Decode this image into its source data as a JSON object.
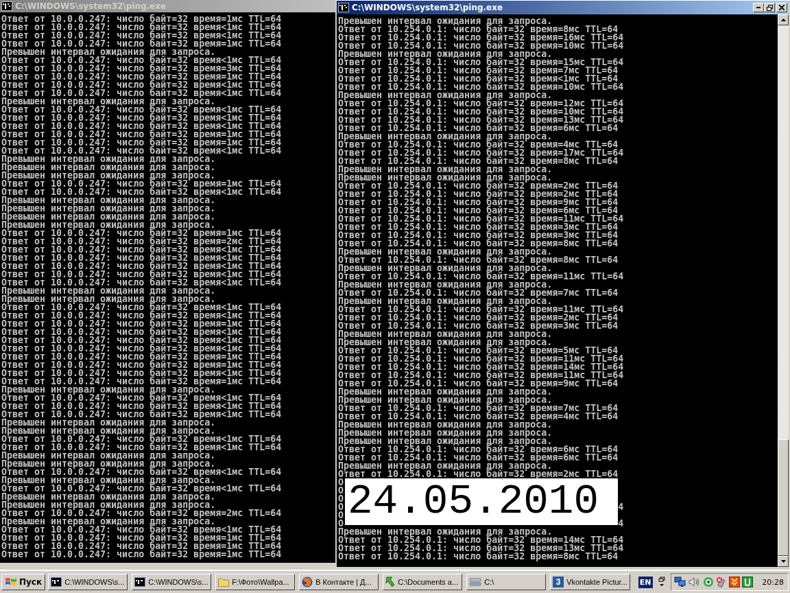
{
  "windows": [
    {
      "title": "C:\\WINDOWS\\system32\\ping.exe",
      "active": false,
      "lines": [
        {
          "kind": "text",
          "text": "Ответ от 10.0.0.247: число байт=32 время=1мс TTL=64"
        },
        {
          "kind": "text",
          "text": "Ответ от 10.0.0.247: число байт=32 время<1мс TTL=64"
        },
        {
          "kind": "text",
          "text": "Ответ от 10.0.0.247: число байт=32 время<1мс TTL=64"
        },
        {
          "kind": "text",
          "text": "Ответ от 10.0.0.247: число байт=32 время=1мс TTL=64"
        },
        {
          "kind": "text",
          "text": "Превышен интервал ожидания для запроса."
        },
        {
          "kind": "text",
          "text": "Ответ от 10.0.0.247: число байт=32 время<1мс TTL=64"
        },
        {
          "kind": "text",
          "text": "Ответ от 10.0.0.247: число байт=32 время=3мс TTL=64"
        },
        {
          "kind": "text",
          "text": "Ответ от 10.0.0.247: число байт=32 время=1мс TTL=64"
        },
        {
          "kind": "text",
          "text": "Ответ от 10.0.0.247: число байт=32 время<1мс TTL=64"
        },
        {
          "kind": "text",
          "text": "Ответ от 10.0.0.247: число байт=32 время<1мс TTL=64"
        },
        {
          "kind": "text",
          "text": "Превышен интервал ожидания для запроса."
        },
        {
          "kind": "text",
          "text": "Ответ от 10.0.0.247: число байт=32 время<1мс TTL=64"
        },
        {
          "kind": "text",
          "text": "Ответ от 10.0.0.247: число байт=32 время<1мс TTL=64"
        },
        {
          "kind": "text",
          "text": "Ответ от 10.0.0.247: число байт=32 время<1мс TTL=64"
        },
        {
          "kind": "text",
          "text": "Ответ от 10.0.0.247: число байт=32 время=1мс TTL=64"
        },
        {
          "kind": "text",
          "text": "Ответ от 10.0.0.247: число байт=32 время=1мс TTL=64"
        },
        {
          "kind": "text",
          "text": "Ответ от 10.0.0.247: число байт=32 время<1мс TTL=64"
        },
        {
          "kind": "text",
          "text": "Превышен интервал ожидания для запроса."
        },
        {
          "kind": "text",
          "text": "Превышен интервал ожидания для запроса."
        },
        {
          "kind": "text",
          "text": "Превышен интервал ожидания для запроса."
        },
        {
          "kind": "text",
          "text": "Ответ от 10.0.0.247: число байт=32 время=1мс TTL=64"
        },
        {
          "kind": "text",
          "text": "Ответ от 10.0.0.247: число байт=32 время<1мс TTL=64"
        },
        {
          "kind": "text",
          "text": "Превышен интервал ожидания для запроса."
        },
        {
          "kind": "text",
          "text": "Превышен интервал ожидания для запроса."
        },
        {
          "kind": "text",
          "text": "Превышен интервал ожидания для запроса."
        },
        {
          "kind": "text",
          "text": "Превышен интервал ожидания для запроса."
        },
        {
          "kind": "text",
          "text": "Ответ от 10.0.0.247: число байт=32 время=1мс TTL=64"
        },
        {
          "kind": "text",
          "text": "Ответ от 10.0.0.247: число байт=32 время=2мс TTL=64"
        },
        {
          "kind": "text",
          "text": "Ответ от 10.0.0.247: число байт=32 время<1мс TTL=64"
        },
        {
          "kind": "text",
          "text": "Ответ от 10.0.0.247: число байт=32 время<1мс TTL=64"
        },
        {
          "kind": "text",
          "text": "Ответ от 10.0.0.247: число байт=32 время<1мс TTL=64"
        },
        {
          "kind": "text",
          "text": "Ответ от 10.0.0.247: число байт=32 время<1мс TTL=64"
        },
        {
          "kind": "text",
          "text": "Ответ от 10.0.0.247: число байт=32 время<1мс TTL=64"
        },
        {
          "kind": "text",
          "text": "Превышен интервал ожидания для запроса."
        },
        {
          "kind": "text",
          "text": "Превышен интервал ожидания для запроса."
        },
        {
          "kind": "text",
          "text": "Ответ от 10.0.0.247: число байт=32 время<1мс TTL=64"
        },
        {
          "kind": "text",
          "text": "Ответ от 10.0.0.247: число байт=32 время<1мс TTL=64"
        },
        {
          "kind": "text",
          "text": "Ответ от 10.0.0.247: число байт=32 время=1мс TTL=64"
        },
        {
          "kind": "text",
          "text": "Ответ от 10.0.0.247: число байт=32 время<1мс TTL=64"
        },
        {
          "kind": "text",
          "text": "Ответ от 10.0.0.247: число байт=32 время<1мс TTL=64"
        },
        {
          "kind": "text",
          "text": "Ответ от 10.0.0.247: число байт=32 время<1мс TTL=64"
        },
        {
          "kind": "text",
          "text": "Ответ от 10.0.0.247: число байт=32 время=1мс TTL=64"
        },
        {
          "kind": "text",
          "text": "Ответ от 10.0.0.247: число байт=32 время=1мс TTL=64"
        },
        {
          "kind": "text",
          "text": "Ответ от 10.0.0.247: число байт=32 время<1мс TTL=64"
        },
        {
          "kind": "text",
          "text": "Ответ от 10.0.0.247: число байт=32 время=1мс TTL=64"
        },
        {
          "kind": "text",
          "text": "Превышен интервал ожидания для запроса."
        },
        {
          "kind": "text",
          "text": "Ответ от 10.0.0.247: число байт=32 время<1мс TTL=64"
        },
        {
          "kind": "text",
          "text": "Ответ от 10.0.0.247: число байт=32 время<1мс TTL=64"
        },
        {
          "kind": "text",
          "text": "Ответ от 10.0.0.247: число байт=32 время<1мс TTL=64"
        },
        {
          "kind": "text",
          "text": "Превышен интервал ожидания для запроса."
        },
        {
          "kind": "text",
          "text": "Превышен интервал ожидания для запроса."
        },
        {
          "kind": "text",
          "text": "Ответ от 10.0.0.247: число байт=32 время<1мс TTL=64"
        },
        {
          "kind": "text",
          "text": "Ответ от 10.0.0.247: число байт=32 время<1мс TTL=64"
        },
        {
          "kind": "text",
          "text": "Превышен интервал ожидания для запроса."
        },
        {
          "kind": "text",
          "text": "Превышен интервал ожидания для запроса."
        },
        {
          "kind": "text",
          "text": "Ответ от 10.0.0.247: число байт=32 время<1мс TTL=64"
        },
        {
          "kind": "text",
          "text": "Превышен интервал ожидания для запроса."
        },
        {
          "kind": "text",
          "text": "Ответ от 10.0.0.247: число байт=32 время<1мс TTL=64"
        },
        {
          "kind": "text",
          "text": "Превышен интервал ожидания для запроса."
        },
        {
          "kind": "text",
          "text": "Превышен интервал ожидания для запроса."
        },
        {
          "kind": "text",
          "text": "Ответ от 10.0.0.247: число байт=32 время=2мс TTL=64"
        },
        {
          "kind": "text",
          "text": "Превышен интервал ожидания для запроса."
        },
        {
          "kind": "text",
          "text": "Ответ от 10.0.0.247: число байт=32 время<1мс TTL=64"
        },
        {
          "kind": "text",
          "text": "Ответ от 10.0.0.247: число байт=32 время=1мс TTL=64"
        },
        {
          "kind": "text",
          "text": "Ответ от 10.0.0.247: число байт=32 время=1мс TTL=64"
        },
        {
          "kind": "text",
          "text": "Ответ от 10.0.0.247: число байт=32 время=1мс TTL=64"
        }
      ]
    },
    {
      "title": "C:\\WINDOWS\\system32\\ping.exe",
      "active": true,
      "lines": [
        {
          "kind": "text",
          "text": "Превышен интервал ожидания для запроса."
        },
        {
          "kind": "text",
          "text": "Ответ от 10.254.0.1: число байт=32 время=8мс TTL=64"
        },
        {
          "kind": "text",
          "text": "Ответ от 10.254.0.1: число байт=32 время=16мс TTL=64"
        },
        {
          "kind": "text",
          "text": "Ответ от 10.254.0.1: число байт=32 время=10мс TTL=64"
        },
        {
          "kind": "text",
          "text": "Превышен интервал ожидания для запроса."
        },
        {
          "kind": "text",
          "text": "Ответ от 10.254.0.1: число байт=32 время=15мс TTL=64"
        },
        {
          "kind": "text",
          "text": "Ответ от 10.254.0.1: число байт=32 время=7мс TTL=64"
        },
        {
          "kind": "text",
          "text": "Ответ от 10.254.0.1: число байт=32 время<1мс TTL=64"
        },
        {
          "kind": "text",
          "text": "Ответ от 10.254.0.1: число байт=32 время=10мс TTL=64"
        },
        {
          "kind": "text",
          "text": "Превышен интервал ожидания для запроса."
        },
        {
          "kind": "text",
          "text": "Ответ от 10.254.0.1: число байт=32 время=12мс TTL=64"
        },
        {
          "kind": "text",
          "text": "Ответ от 10.254.0.1: число байт=32 время=10мс TTL=64"
        },
        {
          "kind": "text",
          "text": "Ответ от 10.254.0.1: число байт=32 время=13мс TTL=64"
        },
        {
          "kind": "text",
          "text": "Ответ от 10.254.0.1: число байт=32 время=6мс TTL=64"
        },
        {
          "kind": "text",
          "text": "Превышен интервал ожидания для запроса."
        },
        {
          "kind": "text",
          "text": "Ответ от 10.254.0.1: число байт=32 время=4мс TTL=64"
        },
        {
          "kind": "text",
          "text": "Ответ от 10.254.0.1: число байт=32 время=17мс TTL=64"
        },
        {
          "kind": "text",
          "text": "Ответ от 10.254.0.1: число байт=32 время=8мс TTL=64"
        },
        {
          "kind": "text",
          "text": "Превышен интервал ожидания для запроса."
        },
        {
          "kind": "text",
          "text": "Превышен интервал ожидания для запроса."
        },
        {
          "kind": "text",
          "text": "Ответ от 10.254.0.1: число байт=32 время=2мс TTL=64"
        },
        {
          "kind": "text",
          "text": "Ответ от 10.254.0.1: число байт=32 время=2мс TTL=64"
        },
        {
          "kind": "text",
          "text": "Ответ от 10.254.0.1: число байт=32 время=9мс TTL=64"
        },
        {
          "kind": "text",
          "text": "Ответ от 10.254.0.1: число байт=32 время=6мс TTL=64"
        },
        {
          "kind": "text",
          "text": "Ответ от 10.254.0.1: число байт=32 время=11мс TTL=64"
        },
        {
          "kind": "text",
          "text": "Ответ от 10.254.0.1: число байт=32 время=3мс TTL=64"
        },
        {
          "kind": "text",
          "text": "Ответ от 10.254.0.1: число байт=32 время=3мс TTL=64"
        },
        {
          "kind": "text",
          "text": "Ответ от 10.254.0.1: число байт=32 время=8мс TTL=64"
        },
        {
          "kind": "text",
          "text": "Превышен интервал ожидания для запроса."
        },
        {
          "kind": "text",
          "text": "Ответ от 10.254.0.1: число байт=32 время=8мс TTL=64"
        },
        {
          "kind": "text",
          "text": "Превышен интервал ожидания для запроса."
        },
        {
          "kind": "text",
          "text": "Ответ от 10.254.0.1: число байт=32 время=11мс TTL=64"
        },
        {
          "kind": "text",
          "text": "Превышен интервал ожидания для запроса."
        },
        {
          "kind": "text",
          "text": "Ответ от 10.254.0.1: число байт=32 время=7мс TTL=64"
        },
        {
          "kind": "text",
          "text": "Превышен интервал ожидания для запроса."
        },
        {
          "kind": "text",
          "text": "Ответ от 10.254.0.1: число байт=32 время=11мс TTL=64"
        },
        {
          "kind": "text",
          "text": "Ответ от 10.254.0.1: число байт=32 время=2мс TTL=64"
        },
        {
          "kind": "text",
          "text": "Ответ от 10.254.0.1: число байт=32 время=3мс TTL=64"
        },
        {
          "kind": "text",
          "text": "Превышен интервал ожидания для запроса."
        },
        {
          "kind": "text",
          "text": "Превышен интервал ожидания для запроса."
        },
        {
          "kind": "text",
          "text": "Ответ от 10.254.0.1: число байт=32 время=5мс TTL=64"
        },
        {
          "kind": "text",
          "text": "Ответ от 10.254.0.1: число байт=32 время=11мс TTL=64"
        },
        {
          "kind": "text",
          "text": "Ответ от 10.254.0.1: число байт=32 время=14мс TTL=64"
        },
        {
          "kind": "text",
          "text": "Ответ от 10.254.0.1: число байт=32 время=11мс TTL=64"
        },
        {
          "kind": "text",
          "text": "Ответ от 10.254.0.1: число байт=32 время=9мс TTL=64"
        },
        {
          "kind": "text",
          "text": "Превышен интервал ожидания для запроса."
        },
        {
          "kind": "text",
          "text": "Превышен интервал ожидания для запроса."
        },
        {
          "kind": "text",
          "text": "Ответ от 10.254.0.1: число байт=32 время=7мс TTL=64"
        },
        {
          "kind": "text",
          "text": "Ответ от 10.254.0.1: число байт=32 время=4мс TTL=64"
        },
        {
          "kind": "text",
          "text": "Превышен интервал ожидания для запроса."
        },
        {
          "kind": "text",
          "text": "Превышен интервал ожидания для запроса."
        },
        {
          "kind": "text",
          "text": "Превышен интервал ожидания для запроса."
        },
        {
          "kind": "text",
          "text": "Ответ от 10.254.0.1: число байт=32 время=6мс TTL=64"
        },
        {
          "kind": "text",
          "text": "Ответ от 10.254.0.1: число байт=32 время=6мс TTL=64"
        },
        {
          "kind": "text",
          "text": "Превышен интервал ожидания для запроса."
        },
        {
          "kind": "text",
          "text": "Ответ от 10.254.0.1: число байт=32 время=2мс TTL=64"
        },
        {
          "kind": "covered",
          "start": "О"
        },
        {
          "kind": "covered",
          "start": "О"
        },
        {
          "kind": "covered",
          "start": "О"
        },
        {
          "kind": "covered",
          "start": "О",
          "end": "4"
        },
        {
          "kind": "covered",
          "start": "О"
        },
        {
          "kind": "covered",
          "start": "О",
          "end": "4"
        },
        {
          "kind": "text",
          "text": "Превышен интервал ожидания для запроса."
        },
        {
          "kind": "text",
          "text": "Ответ от 10.254.0.1: число байт=32 время=14мс TTL=64"
        },
        {
          "kind": "text",
          "text": "Ответ от 10.254.0.1: число байт=32 время=13мс TTL=64"
        },
        {
          "kind": "text",
          "text": "Ответ от 10.254.0.1: число байт=32 время=8мс TTL=64"
        }
      ]
    }
  ],
  "date_stamp": "24.05.2010",
  "taskbar": {
    "start_label": "Пуск",
    "tasks": [
      {
        "kind": "console",
        "label": "C:\\WINDOWS\\s..."
      },
      {
        "kind": "console",
        "label": "C:\\WINDOWS\\s..."
      },
      {
        "kind": "folder",
        "label": "F:\\Фото\\Wallpa..."
      },
      {
        "kind": "browser",
        "label": "В Контакте | Д..."
      },
      {
        "kind": "arrow",
        "label": "C:\\Documents a..."
      },
      {
        "kind": "drive",
        "label": "C:\\"
      },
      {
        "kind": "badge",
        "badge": "3",
        "label": "Vkontakte Pictur..."
      }
    ],
    "language": "EN",
    "clock": "20:28"
  }
}
